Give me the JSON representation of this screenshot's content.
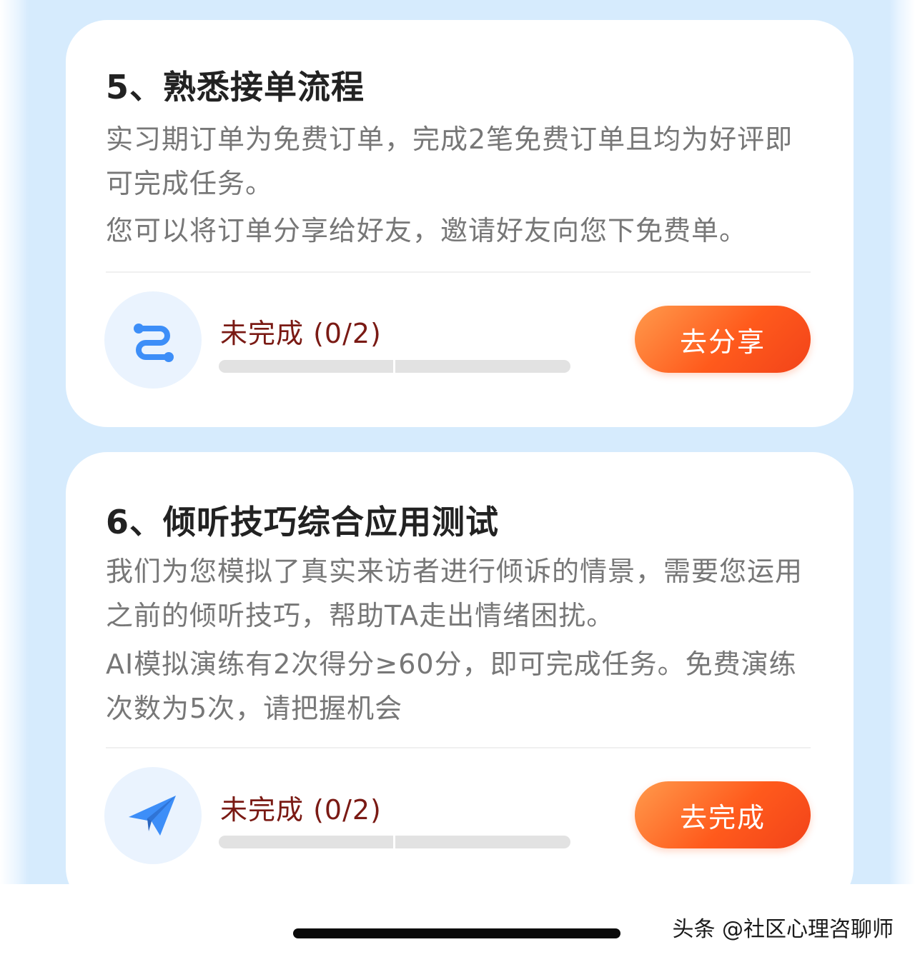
{
  "tasks": [
    {
      "title": "5、熟悉接单流程",
      "description_lines": [
        "实习期订单为免费订单，完成2笔免费订单且均为好评即可完成任务。",
        "您可以将订单分享给好友，邀请好友向您下免费单。"
      ],
      "icon": "route-icon",
      "status": "未完成 (0/2)",
      "progress": {
        "done": 0,
        "total": 2
      },
      "action_label": "去分享"
    },
    {
      "title": "6、倾听技巧综合应用测试",
      "description_lines": [
        "我们为您模拟了真实来访者进行倾诉的情景，需要您运用之前的倾听技巧，帮助TA走出情绪困扰。",
        "AI模拟演练有2次得分≥60分，即可完成任务。免费演练次数为5次，请把握机会"
      ],
      "icon": "paper-plane-icon",
      "status": "未完成 (0/2)",
      "progress": {
        "done": 0,
        "total": 2
      },
      "action_label": "去完成"
    }
  ],
  "colors": {
    "page_background": "#d6ebfd",
    "status_text": "#7a1a14",
    "button_accent": "#ff5a1c",
    "icon_blue": "#3d8ef8"
  },
  "watermark": "头条 @社区心理咨聊师"
}
